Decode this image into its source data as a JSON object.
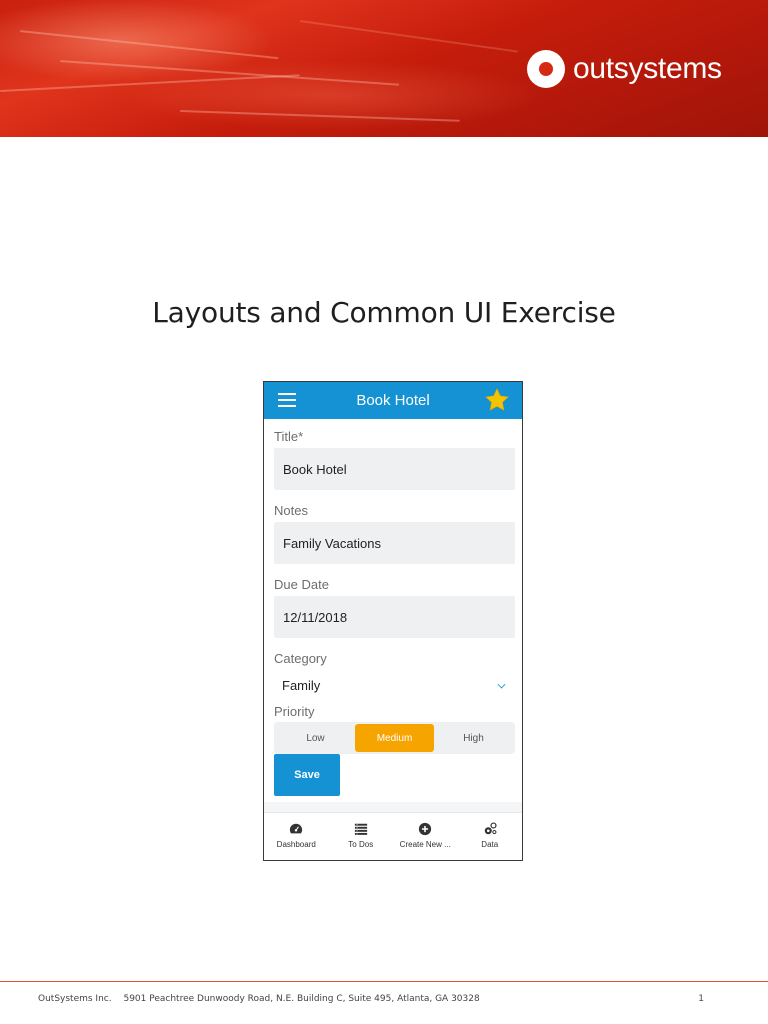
{
  "header": {
    "logo_text": "outsystems",
    "banner_color": "#c9200f"
  },
  "document": {
    "title": "Layouts and Common UI Exercise"
  },
  "phone": {
    "appbar": {
      "title": "Book Hotel",
      "menu_icon": "hamburger-icon",
      "favorite_icon": "star-icon",
      "color": "#1592d3",
      "star_color": "#f5c400"
    },
    "form": {
      "title_label": "Title*",
      "title_value": "Book Hotel",
      "notes_label": "Notes",
      "notes_value": "Family Vacations",
      "due_date_label": "Due Date",
      "due_date_value": "12/11/2018",
      "category_label": "Category",
      "category_value": "Family",
      "priority_label": "Priority",
      "priority_options": [
        "Low",
        "Medium",
        "High"
      ],
      "priority_selected": "Medium",
      "priority_active_color": "#f5a400",
      "save_label": "Save"
    },
    "tabbar": {
      "tabs": [
        {
          "label": "Dashboard",
          "icon": "dashboard-icon"
        },
        {
          "label": "To Dos",
          "icon": "list-icon"
        },
        {
          "label": "Create New ...",
          "icon": "add-circle-icon"
        },
        {
          "label": "Data",
          "icon": "gears-icon"
        }
      ]
    }
  },
  "footer": {
    "company": "OutSystems Inc.",
    "address": "5901 Peachtree Dunwoody Road, N.E. Building C, Suite 495, Atlanta, GA 30328",
    "page_number": "1",
    "line_color": "#e2522e"
  }
}
